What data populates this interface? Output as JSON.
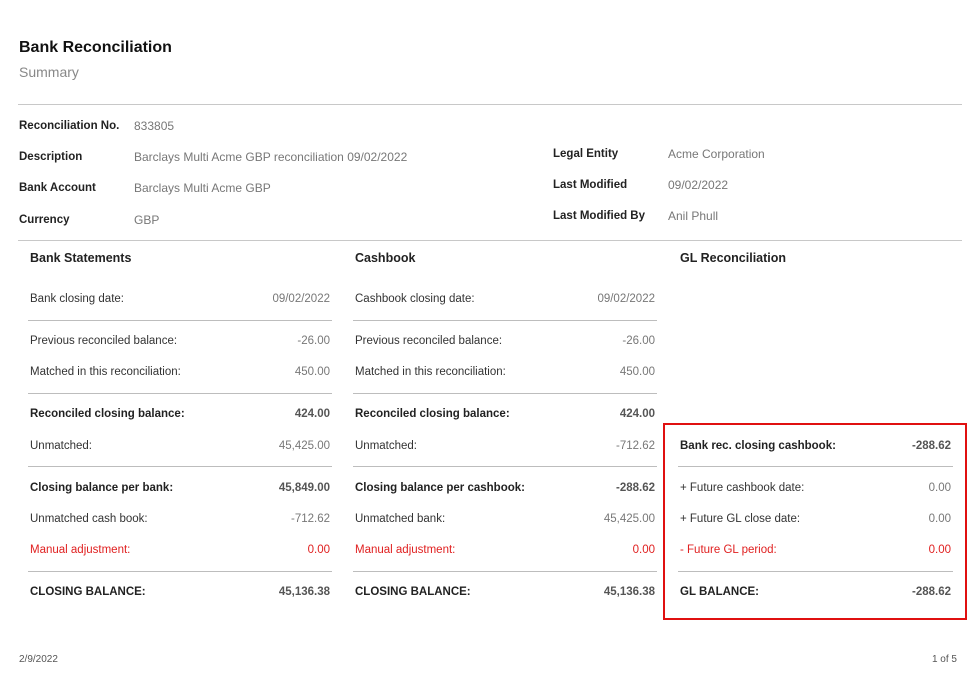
{
  "header": {
    "title": "Bank Reconciliation",
    "subtitle": "Summary"
  },
  "meta": {
    "reconciliation_no": {
      "label": "Reconciliation No.",
      "value": "833805"
    },
    "description": {
      "label": "Description",
      "value": "Barclays Multi Acme GBP reconciliation 09/02/2022"
    },
    "bank_account": {
      "label": "Bank Account",
      "value": "Barclays Multi Acme GBP"
    },
    "currency": {
      "label": "Currency",
      "value": "GBP"
    },
    "legal_entity": {
      "label": "Legal Entity",
      "value": "Acme Corporation"
    },
    "last_modified": {
      "label": "Last Modified",
      "value": "09/02/2022"
    },
    "last_modified_by": {
      "label": "Last Modified By",
      "value": "Anil Phull"
    }
  },
  "bank": {
    "heading": "Bank Statements",
    "closing_date": {
      "label": "Bank closing date:",
      "value": "09/02/2022"
    },
    "previous": {
      "label": "Previous reconciled balance:",
      "value": "-26.00"
    },
    "matched": {
      "label": "Matched in this reconciliation:",
      "value": "450.00"
    },
    "reconciled": {
      "label": "Reconciled closing balance:",
      "value": "424.00"
    },
    "unmatched": {
      "label": "Unmatched:",
      "value": "45,425.00"
    },
    "closing_per": {
      "label": "Closing balance per bank:",
      "value": "45,849.00"
    },
    "unmatched_other": {
      "label": "Unmatched cash book:",
      "value": "-712.62"
    },
    "manual": {
      "label": "Manual adjustment:",
      "value": "0.00"
    },
    "closing_balance": {
      "label": "CLOSING BALANCE:",
      "value": "45,136.38"
    }
  },
  "cashbook": {
    "heading": "Cashbook",
    "closing_date": {
      "label": "Cashbook closing date:",
      "value": "09/02/2022"
    },
    "previous": {
      "label": "Previous reconciled balance:",
      "value": "-26.00"
    },
    "matched": {
      "label": "Matched in this reconciliation:",
      "value": "450.00"
    },
    "reconciled": {
      "label": "Reconciled closing balance:",
      "value": "424.00"
    },
    "unmatched": {
      "label": "Unmatched:",
      "value": "-712.62"
    },
    "closing_per": {
      "label": "Closing balance per cashbook:",
      "value": "-288.62"
    },
    "unmatched_other": {
      "label": "Unmatched bank:",
      "value": "45,425.00"
    },
    "manual": {
      "label": "Manual adjustment:",
      "value": "0.00"
    },
    "closing_balance": {
      "label": "CLOSING BALANCE:",
      "value": "45,136.38"
    }
  },
  "gl": {
    "heading": "GL Reconciliation",
    "bank_rec": {
      "label": "Bank rec. closing cashbook:",
      "value": "-288.62"
    },
    "future_cashbook": {
      "label": "+ Future cashbook date:",
      "value": "0.00"
    },
    "future_gl_close": {
      "label": "+ Future GL close date:",
      "value": "0.00"
    },
    "future_gl_period": {
      "label": "- Future GL period:",
      "value": "0.00"
    },
    "gl_balance": {
      "label": "GL BALANCE:",
      "value": "-288.62"
    }
  },
  "footer": {
    "date": "2/9/2022",
    "page": "1 of 5"
  },
  "colors": {
    "highlight": "#e01010",
    "adjustment_red": "#e02020"
  }
}
